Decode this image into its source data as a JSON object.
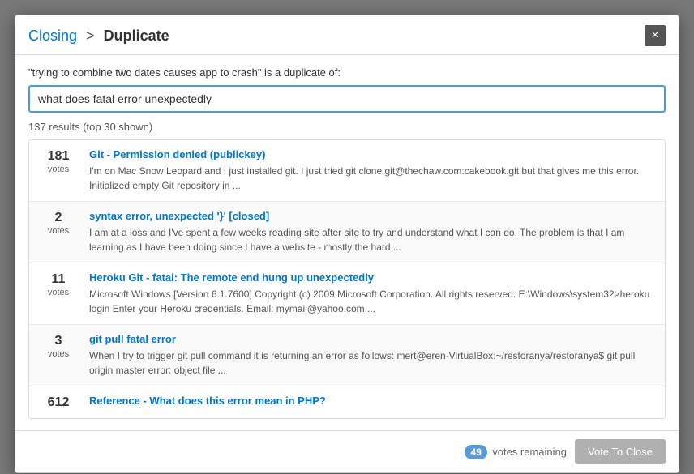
{
  "modal": {
    "title": {
      "closing_label": "Closing",
      "separator": ">",
      "duplicate_label": "Duplicate"
    },
    "close_icon": "×",
    "duplicate_question_label": "\"trying to combine two dates causes app to crash\" is a duplicate of:",
    "search_input_value": "what does fatal error unexpectedly",
    "search_placeholder": "what does fatal error unexpectedly",
    "results_count_label": "137 results (top 30 shown)"
  },
  "results": [
    {
      "votes": "181",
      "votes_label": "votes",
      "title": "Git - Permission denied (publickey)",
      "excerpt": "I'm on Mac Snow Leopard and I just installed git. I just tried git clone git@thechaw.com:cakebook.git but that gives me this error. Initialized empty Git repository in ..."
    },
    {
      "votes": "2",
      "votes_label": "votes",
      "title": "syntax error, unexpected '}' [closed]",
      "excerpt": "I am at a loss and I've spent a few weeks reading site after site to try and understand what I can do. The problem is that I am learning as I have been doing since I have a website - mostly the hard ..."
    },
    {
      "votes": "11",
      "votes_label": "votes",
      "title": "Heroku Git - fatal: The remote end hung up unexpectedly",
      "excerpt": "Microsoft Windows [Version 6.1.7600] Copyright (c) 2009 Microsoft Corporation. All rights reserved. E:\\Windows\\system32>heroku login Enter your Heroku credentials. Email: mymail@yahoo.com ..."
    },
    {
      "votes": "3",
      "votes_label": "votes",
      "title": "git pull fatal error",
      "excerpt": "When I try to trigger git pull command it is returning an error as follows: mert@eren-VirtualBox:~/restoranya/restoranya$ git pull origin master error: object file ..."
    },
    {
      "votes": "612",
      "votes_label": "",
      "title": "Reference - What does this error mean in PHP?",
      "excerpt": ""
    }
  ],
  "footer": {
    "votes_remaining_count": "49",
    "votes_remaining_label": "votes remaining",
    "vote_close_button_label": "Vote To Close"
  }
}
